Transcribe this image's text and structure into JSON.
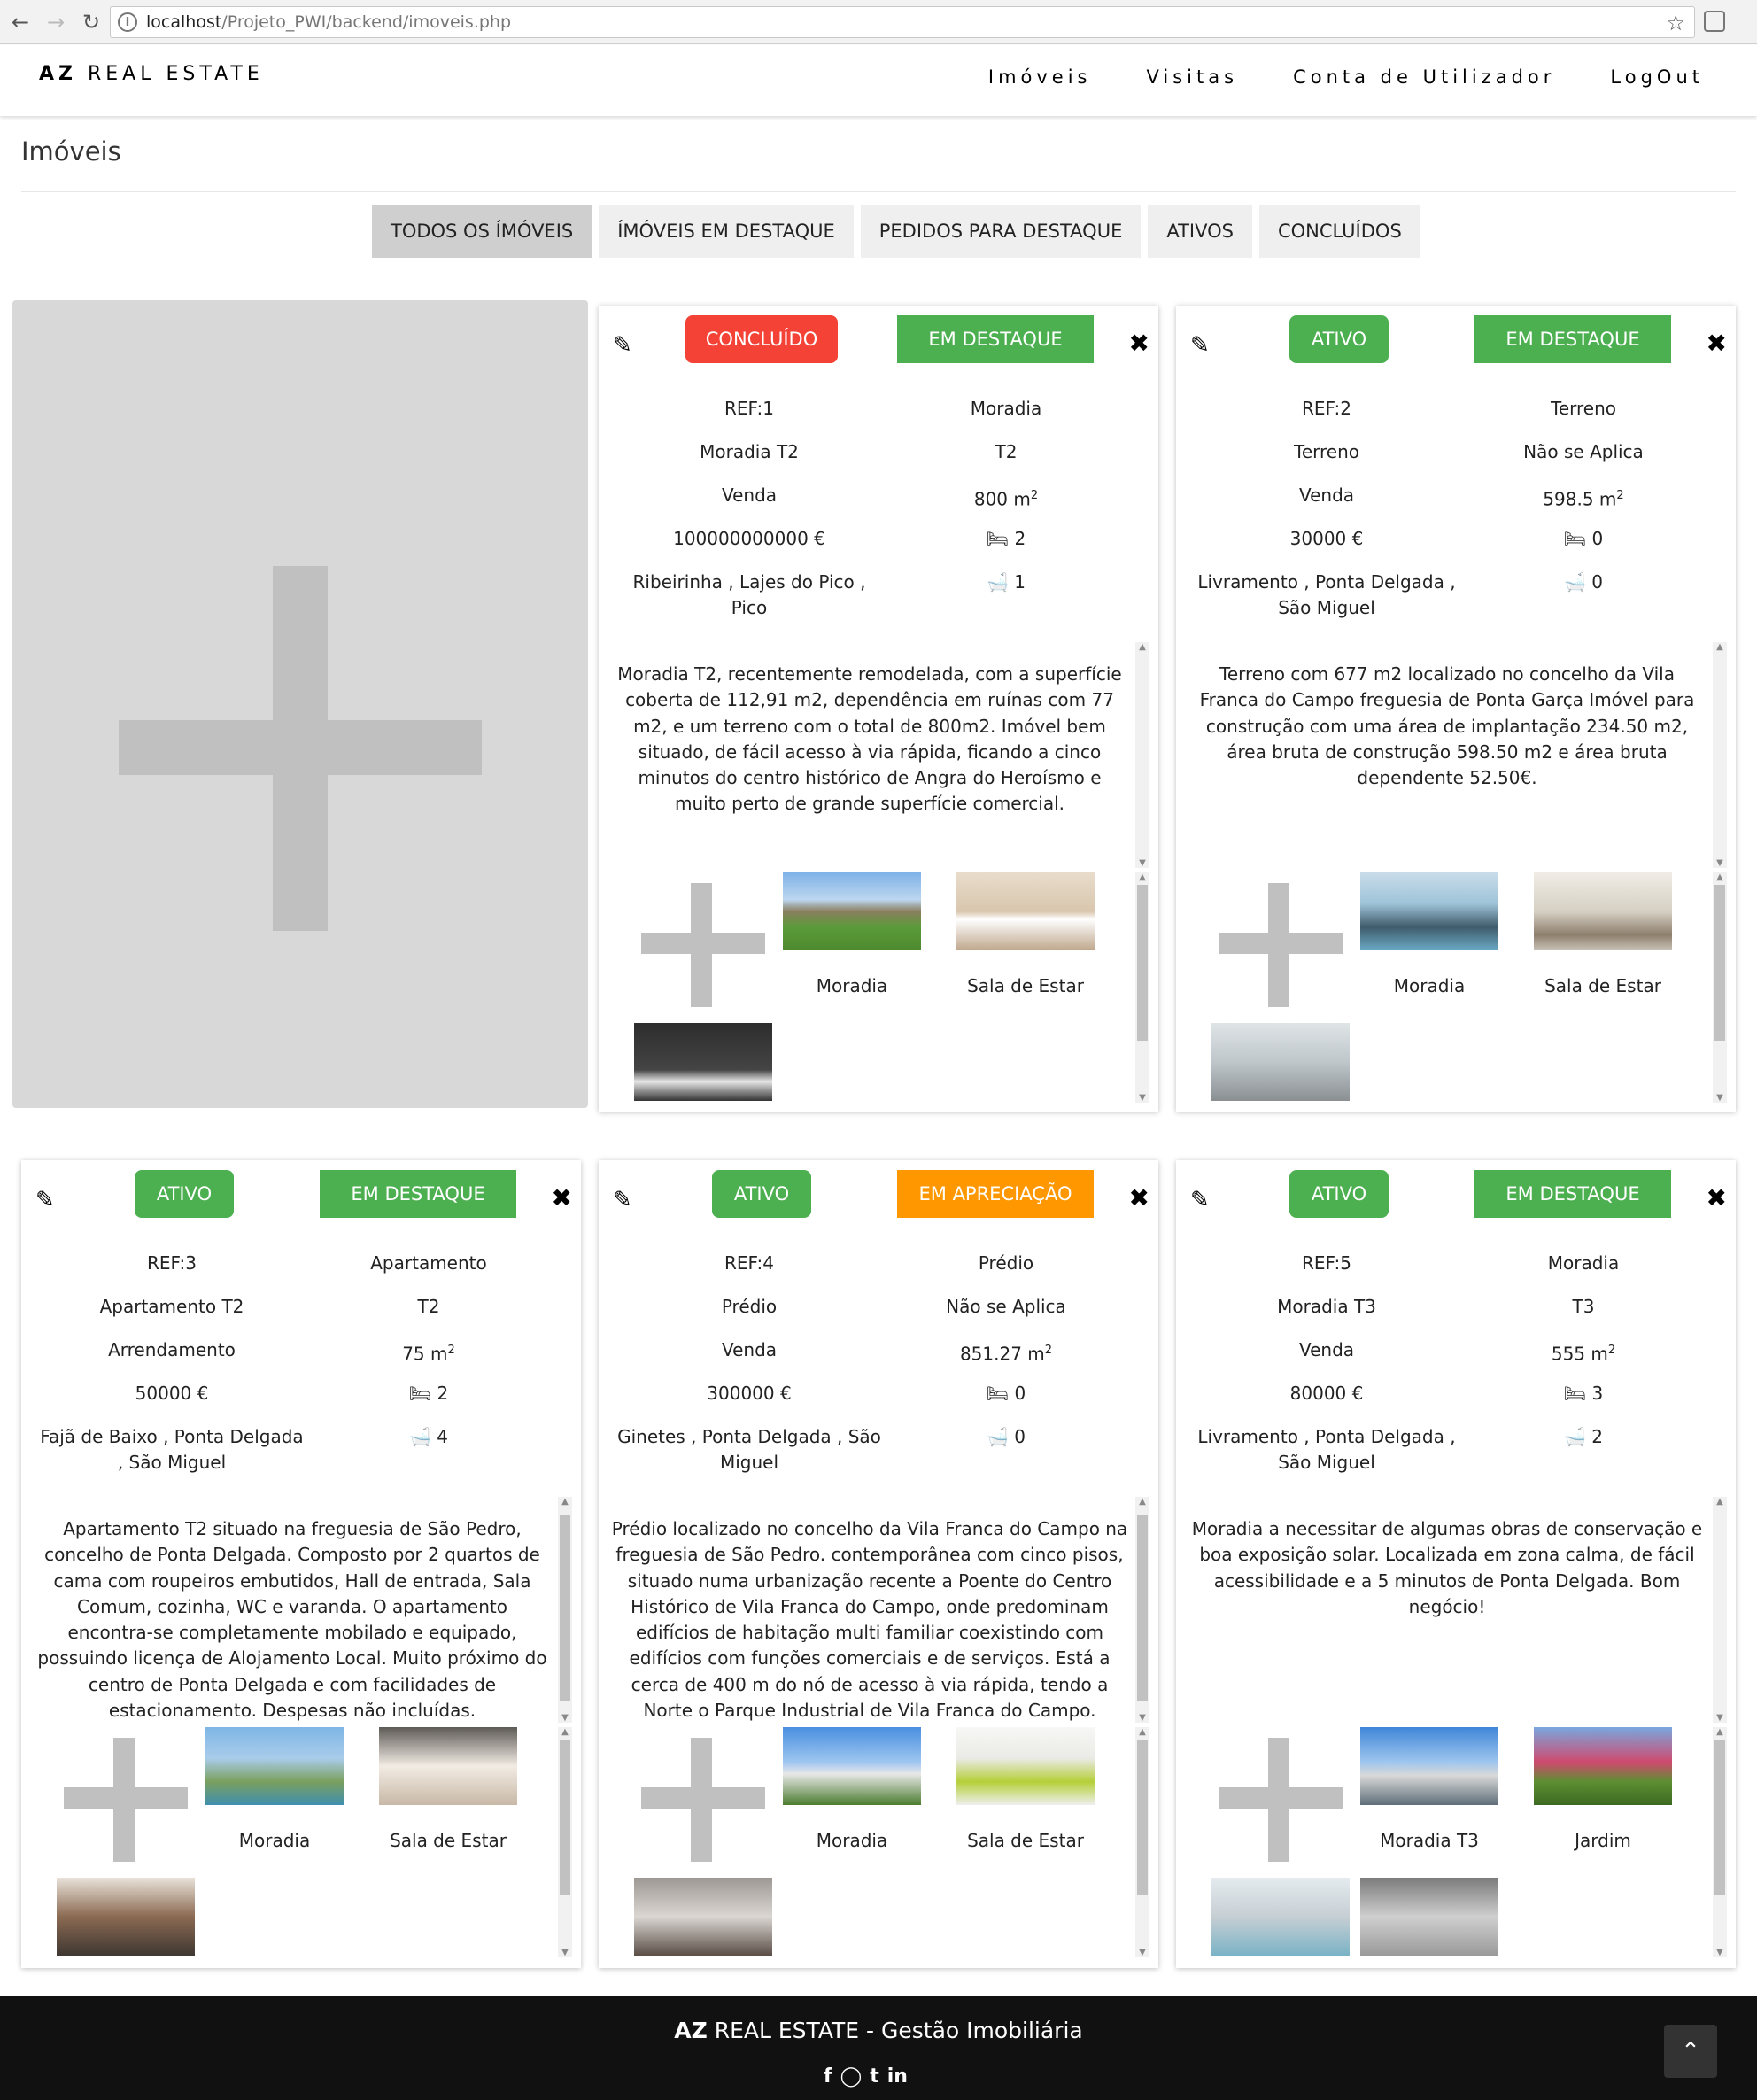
{
  "browser": {
    "url_host": "localhost",
    "url_path": "/Projeto_PWI/backend/imoveis.php"
  },
  "navbar": {
    "brand_bold": "AZ",
    "brand_rest": "REAL ESTATE",
    "menu": [
      "Imóveis",
      "Visitas",
      "Conta de Utilizador",
      "LogOut"
    ]
  },
  "page": {
    "title": "Imóveis",
    "tabs": [
      "TODOS OS ÍMÓVEIS",
      "ÍMÓVEIS EM DESTAQUE",
      "PEDIDOS PARA DESTAQUE",
      "ATIVOS",
      "CONCLUÍDOS"
    ],
    "active_tab": "TODOS OS ÍMÓVEIS"
  },
  "colors": {
    "green": "#4caf50",
    "red": "#f44336",
    "orange": "#ff9800"
  },
  "properties": [
    {
      "status": "CONCLUÍDO",
      "status_color": "#f44336",
      "feature": "EM DESTAQUE",
      "feature_color": "#4caf50",
      "ref": "REF:1",
      "type": "Moradia",
      "name": "Moradia T2",
      "typology": "T2",
      "deal": "Venda",
      "area": "800 m",
      "area_sup": "2",
      "price": "100000000000 €",
      "bedrooms": "2",
      "location": "Ribeirinha , Lajes do Pico , Pico",
      "bathrooms": "1",
      "description": "Moradia T2, recentemente remodelada, com a superfície coberta de 112,91 m2, dependência em ruínas com 77 m2, e um terreno com o total de 800m2. Imóvel bem situado, de fácil acesso à via rápida, ficando a cinco minutos do centro histórico de Angra do Heroísmo e muito perto de grande superfície comercial.",
      "photos": [
        "Moradia",
        "Sala de Estar",
        ""
      ]
    },
    {
      "status": "ATIVO",
      "status_color": "#4caf50",
      "feature": "EM DESTAQUE",
      "feature_color": "#4caf50",
      "ref": "REF:2",
      "type": "Terreno",
      "name": "Terreno",
      "typology": "Não se Aplica",
      "deal": "Venda",
      "area": "598.5 m",
      "area_sup": "2",
      "price": "30000 €",
      "bedrooms": "0",
      "location": "Livramento , Ponta Delgada , São Miguel",
      "bathrooms": "0",
      "description": "Terreno com 677 m2 localizado no concelho da Vila Franca do Campo freguesia de Ponta Garça Imóvel para construção com uma área de implantação 234.50 m2, área bruta de construção 598.50 m2 e área bruta dependente 52.50€.",
      "photos": [
        "Moradia",
        "Sala de Estar",
        ""
      ]
    },
    {
      "status": "ATIVO",
      "status_color": "#4caf50",
      "feature": "EM DESTAQUE",
      "feature_color": "#4caf50",
      "ref": "REF:3",
      "type": "Apartamento",
      "name": "Apartamento T2",
      "typology": "T2",
      "deal": "Arrendamento",
      "area": "75 m",
      "area_sup": "2",
      "price": "50000 €",
      "bedrooms": "2",
      "location": "Fajã de Baixo , Ponta Delgada , São Miguel",
      "bathrooms": "4",
      "description": "Apartamento T2 situado na freguesia de São Pedro, concelho de Ponta Delgada. Composto por 2 quartos de cama com roupeiros embutidos, Hall de entrada, Sala Comum, cozinha, WC e varanda. O apartamento encontra-se completamente mobilado e equipado, possuindo licença de Alojamento Local. Muito próximo do centro de Ponta Delgada e com facilidades de estacionamento. Despesas não incluídas.",
      "photos": [
        "Moradia",
        "Sala de Estar",
        ""
      ]
    },
    {
      "status": "ATIVO",
      "status_color": "#4caf50",
      "feature": "EM APRECIAÇÃO",
      "feature_color": "#ff9800",
      "ref": "REF:4",
      "type": "Prédio",
      "name": "Prédio",
      "typology": "Não se Aplica",
      "deal": "Venda",
      "area": "851.27 m",
      "area_sup": "2",
      "price": "300000 €",
      "bedrooms": "0",
      "location": "Ginetes , Ponta Delgada , São Miguel",
      "bathrooms": "0",
      "description": "Prédio localizado no concelho da Vila Franca do Campo na freguesia de São Pedro. contemporânea com cinco pisos, situado numa urbanização recente a Poente do Centro Histórico de Vila Franca do Campo, onde predominam edifícios de habitação multi familiar coexistindo com edifícios com funções comerciais e de serviços. Está a cerca de 400 m do nó de acesso à via rápida, tendo a Norte o Parque Industrial de Vila Franca do Campo.",
      "photos": [
        "Moradia",
        "Sala de Estar",
        ""
      ]
    },
    {
      "status": "ATIVO",
      "status_color": "#4caf50",
      "feature": "EM DESTAQUE",
      "feature_color": "#4caf50",
      "ref": "REF:5",
      "type": "Moradia",
      "name": "Moradia T3",
      "typology": "T3",
      "deal": "Venda",
      "area": "555 m",
      "area_sup": "2",
      "price": "80000 €",
      "bedrooms": "3",
      "location": "Livramento , Ponta Delgada , São Miguel",
      "bathrooms": "2",
      "description": "Moradia a necessitar de algumas obras de conservação e boa exposição solar. Localizada em zona calma, de fácil acessibilidade e a 5 minutos de Ponta Delgada. Bom negócio!",
      "photos": [
        "Moradia T3",
        "Jardim",
        "",
        ""
      ]
    }
  ],
  "footer": {
    "brand_bold": "AZ",
    "brand_rest": "REAL ESTATE - Gestão Imobiliária",
    "social_icons": [
      "facebook-icon",
      "instagram-icon",
      "twitter-icon",
      "linkedin-icon"
    ]
  }
}
